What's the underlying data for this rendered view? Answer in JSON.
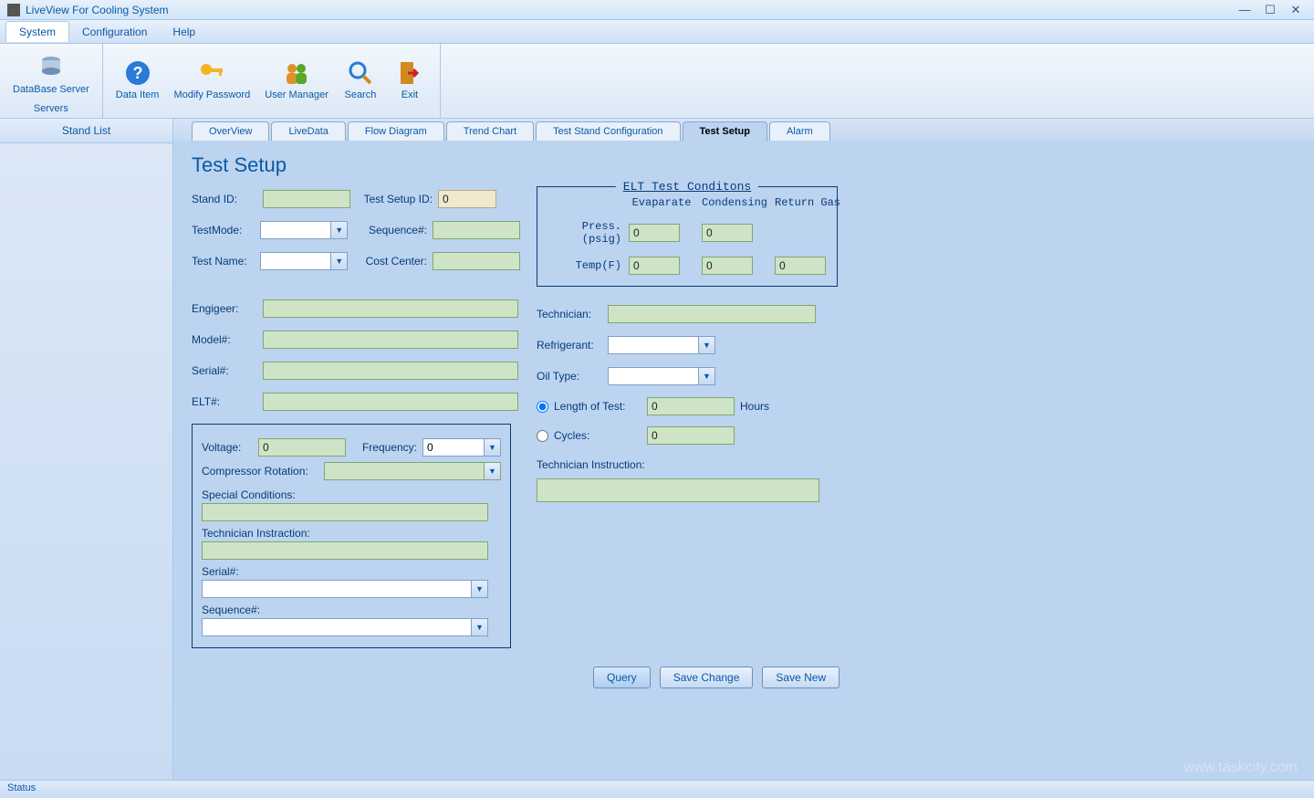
{
  "window": {
    "title": "LiveView For Cooling System",
    "min": "—",
    "max": "☐",
    "close": "✕"
  },
  "menu": {
    "items": [
      "System",
      "Configuration",
      "Help"
    ],
    "active_index": 0
  },
  "ribbon": {
    "groups": [
      {
        "label": "Servers",
        "buttons": [
          {
            "label": "DataBase Server",
            "icon": "database-icon"
          }
        ]
      },
      {
        "label": "",
        "buttons": [
          {
            "label": "Data Item",
            "icon": "help-icon"
          },
          {
            "label": "Modify Password",
            "icon": "key-icon"
          },
          {
            "label": "User Manager",
            "icon": "users-icon"
          },
          {
            "label": "Search",
            "icon": "search-icon"
          },
          {
            "label": "Exit",
            "icon": "exit-icon"
          }
        ]
      }
    ]
  },
  "sidebar": {
    "header": "Stand List"
  },
  "tabs": {
    "items": [
      "OverView",
      "LiveData",
      "Flow Diagram",
      "Trend Chart",
      "Test Stand Configuration",
      "Test Setup",
      "Alarm"
    ],
    "active_index": 5
  },
  "page": {
    "title": "Test Setup",
    "labels": {
      "stand_id": "Stand ID:",
      "test_mode": "TestMode:",
      "test_name": "Test Name:",
      "test_setup_id": "Test Setup ID:",
      "sequence": "Sequence#:",
      "cost_center": "Cost Center:",
      "engineer": "Engigeer:",
      "model": "Model#:",
      "serial": "Serial#:",
      "elt": "ELT#:",
      "technician": "Technician:",
      "refrigerant": "Refrigerant:",
      "oil_type": "Oil Type:",
      "length_of_test": "Length of Test:",
      "cycles": "Cycles:",
      "hours": "Hours",
      "technician_instruction": "Technician Instruction:",
      "voltage": "Voltage:",
      "frequency": "Frequency:",
      "compressor_rotation": "Compressor Rotation:",
      "special_conditions": "Special Conditions:",
      "technician_instraction": "Technician Instraction:",
      "serial_box": "Serial#:",
      "sequence_box": "Sequence#:"
    },
    "values": {
      "stand_id": "",
      "test_mode": "",
      "test_name": "",
      "test_setup_id": "0",
      "sequence": "",
      "cost_center": "",
      "engineer": "",
      "model": "",
      "serial": "",
      "elt": "",
      "technician": "",
      "refrigerant": "",
      "oil_type": "",
      "length_of_test": "0",
      "cycles": "0",
      "technician_instruction": "",
      "voltage": "0",
      "frequency": "0",
      "compressor_rotation": "",
      "special_conditions": "",
      "technician_instraction": "",
      "serial_box": "",
      "sequence_box": ""
    },
    "elt": {
      "title": "ELT Test Conditons",
      "cols": {
        "evap": "Evaparate",
        "cond": "Condensing",
        "ret": "Return Gas"
      },
      "rows": {
        "press": "Press.(psig)",
        "temp": "Temp(F)"
      },
      "press": {
        "evap": "0",
        "cond": "0",
        "ret": ""
      },
      "temp": {
        "evap": "0",
        "cond": "0",
        "ret": "0"
      }
    },
    "radio_selected": "length",
    "buttons": {
      "query": "Query",
      "save_change": "Save Change",
      "save_new": "Save New"
    }
  },
  "status": {
    "text": "Status"
  },
  "watermark": "www.taskcity.com"
}
